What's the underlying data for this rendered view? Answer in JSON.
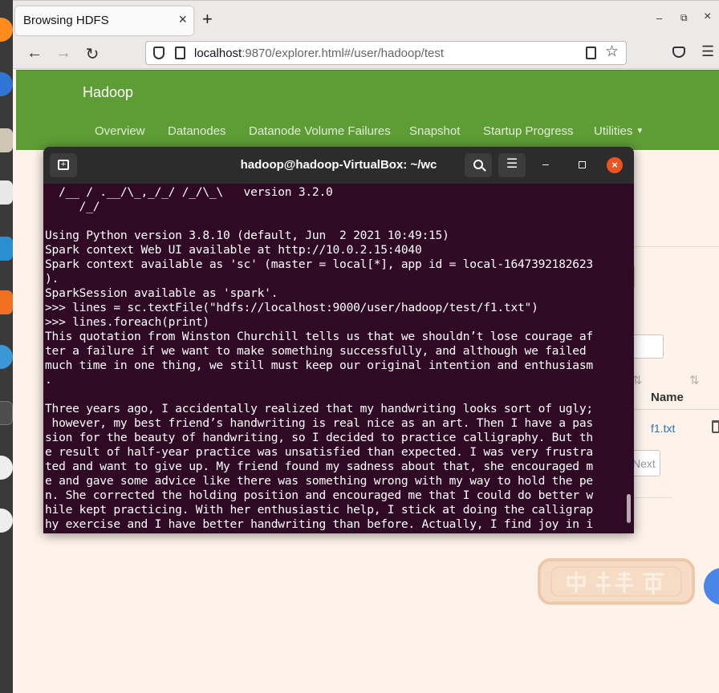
{
  "browser": {
    "tab_title": "Browsing HDFS",
    "tab_close": "×",
    "new_tab": "+",
    "url_host": "localhost",
    "url_rest": ":9870/explorer.html#/user/hadoop/test"
  },
  "hadoop": {
    "brand": "Hadoop",
    "nav": [
      "Overview",
      "Datanodes",
      "Datanode Volume Failures",
      "Snapshot",
      "Startup Progress",
      "Utilities"
    ],
    "table_header_name": "Name",
    "file_name": "f1.txt",
    "next_label": "Next",
    "sort_icon": "⇅"
  },
  "terminal": {
    "title": "hadoop@hadoop-VirtualBox: ~/wc",
    "lines": [
      "  /__ / .__/\\_,_/_/ /_/\\_\\   version 3.2.0",
      "     /_/",
      "",
      "Using Python version 3.8.10 (default, Jun  2 2021 10:49:15)",
      "Spark context Web UI available at http://10.0.2.15:4040",
      "Spark context available as 'sc' (master = local[*], app id = local-1647392182623",
      ").",
      "SparkSession available as 'spark'.",
      ">>> lines = sc.textFile(\"hdfs://localhost:9000/user/hadoop/test/f1.txt\")",
      ">>> lines.foreach(print)",
      "This quotation from Winston Churchill tells us that we shouldn’t lose courage af",
      "ter a failure if we want to make something successfully, and although we failed",
      "much time in one thing, we still must keep our original intention and enthusiasm",
      ".",
      "",
      "Three years ago, I accidentally realized that my handwriting looks sort of ugly;",
      " however, my best friend’s handwriting is real nice as an art. Then I have a pas",
      "sion for the beauty of handwriting, so I decided to practice calligraphy. But th",
      "e result of half-year practice was unsatisfied than expected. I was very frustra",
      "ted and want to give up. My friend found my sadness about that, she encouraged m",
      "e and gave some advice like there was something wrong with my way to hold the pe",
      "n. She corrected the holding position and encouraged me that I could do better w",
      "hile kept practicing. With her enthusiastic help, I stick at doing the calligrap",
      "hy exercise and I have better handwriting than before. Actually, I find joy in i"
    ]
  },
  "watermark": {
    "text": "中文字帖"
  },
  "icons": {
    "back": "←",
    "forward": "→",
    "reload": "↻",
    "star": "☆",
    "menu": "☰",
    "minimize": "–",
    "maximize": "▫",
    "restore": "⧉",
    "close": "×"
  },
  "colors": {
    "hadoop_green": "#5e9c35",
    "terminal_bg": "#300a24",
    "terminal_close": "#e95420",
    "page_bg": "#fdf3ea"
  }
}
